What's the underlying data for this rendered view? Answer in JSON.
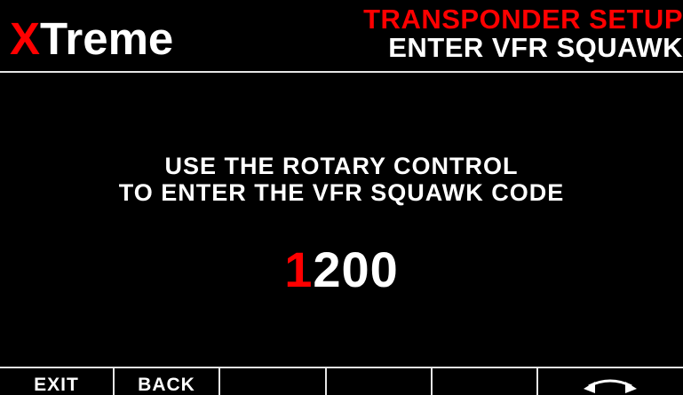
{
  "header": {
    "logo_first_letter": "X",
    "logo_rest": "Treme",
    "title_line1": "TRANSPONDER SETUP",
    "title_line2": "ENTER VFR SQUAWK"
  },
  "main": {
    "instruction_line1": "USE THE ROTARY CONTROL",
    "instruction_line2": "TO ENTER THE VFR SQUAWK CODE",
    "squawk_active_digit": "1",
    "squawk_remaining_digits": "200"
  },
  "softkeys": [
    {
      "label": "EXIT"
    },
    {
      "label": "BACK"
    },
    {
      "label": ""
    },
    {
      "label": ""
    },
    {
      "label": ""
    },
    {
      "label": "",
      "icon": "rotary-arrows-icon"
    }
  ],
  "colors": {
    "accent": "#ff0000",
    "text": "#ffffff",
    "background": "#000000",
    "line": "#e6e6e6"
  }
}
